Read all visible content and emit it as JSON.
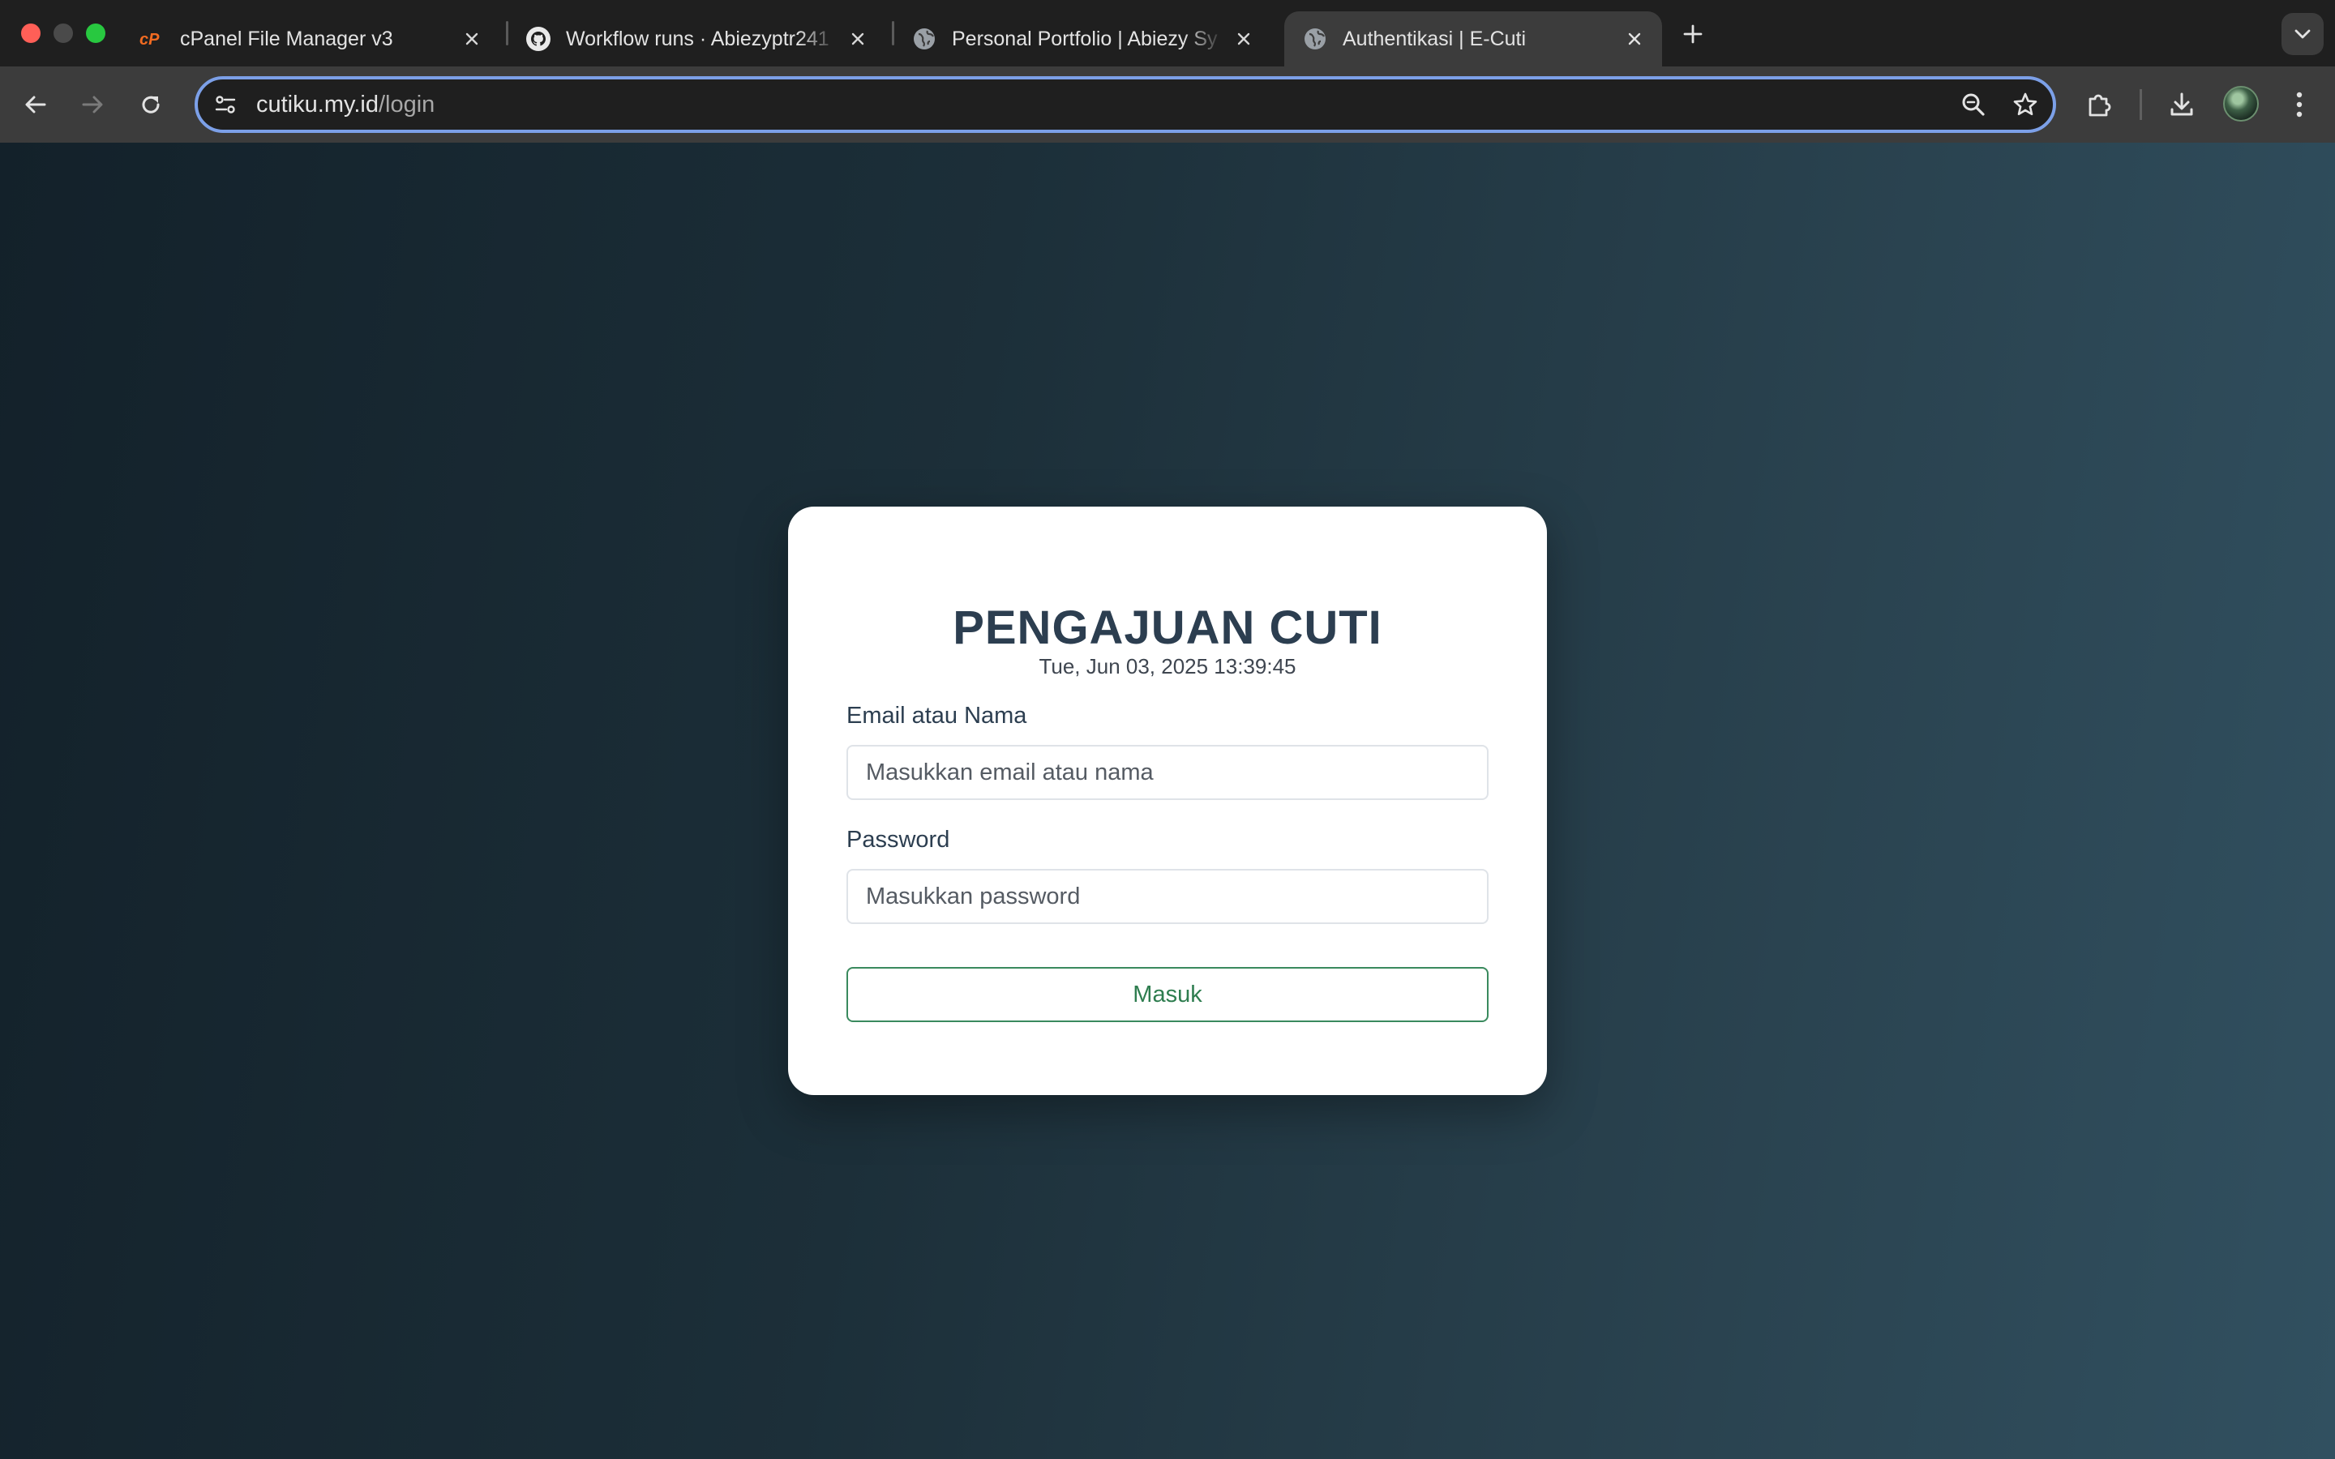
{
  "browser": {
    "tabs": [
      {
        "title": "cPanel File Manager v3",
        "favicon": "cpanel-icon",
        "active": false
      },
      {
        "title": "Workflow runs · Abiezyptr241",
        "favicon": "github-icon",
        "active": false
      },
      {
        "title": "Personal Portfolio | Abiezy Sy",
        "favicon": "globe-icon",
        "active": false
      },
      {
        "title": "Authentikasi | E-Cuti",
        "favicon": "globe-icon",
        "active": true
      }
    ],
    "address_bar": {
      "host": "cutiku.my.id",
      "path": "/login"
    },
    "colors": {
      "omnibox_focus": "#7ca0e8",
      "tab_active": "#3c3c3c"
    }
  },
  "login": {
    "title": "PENGAJUAN CUTI",
    "datetime": "Tue, Jun 03, 2025 13:39:45",
    "email_label": "Email atau Nama",
    "email_placeholder": "Masukkan email atau nama",
    "email_value": "",
    "password_label": "Password",
    "password_placeholder": "Masukkan password",
    "password_value": "",
    "submit_label": "Masuk",
    "colors": {
      "title": "#2c3e50",
      "button": "#2e7d4f"
    }
  }
}
